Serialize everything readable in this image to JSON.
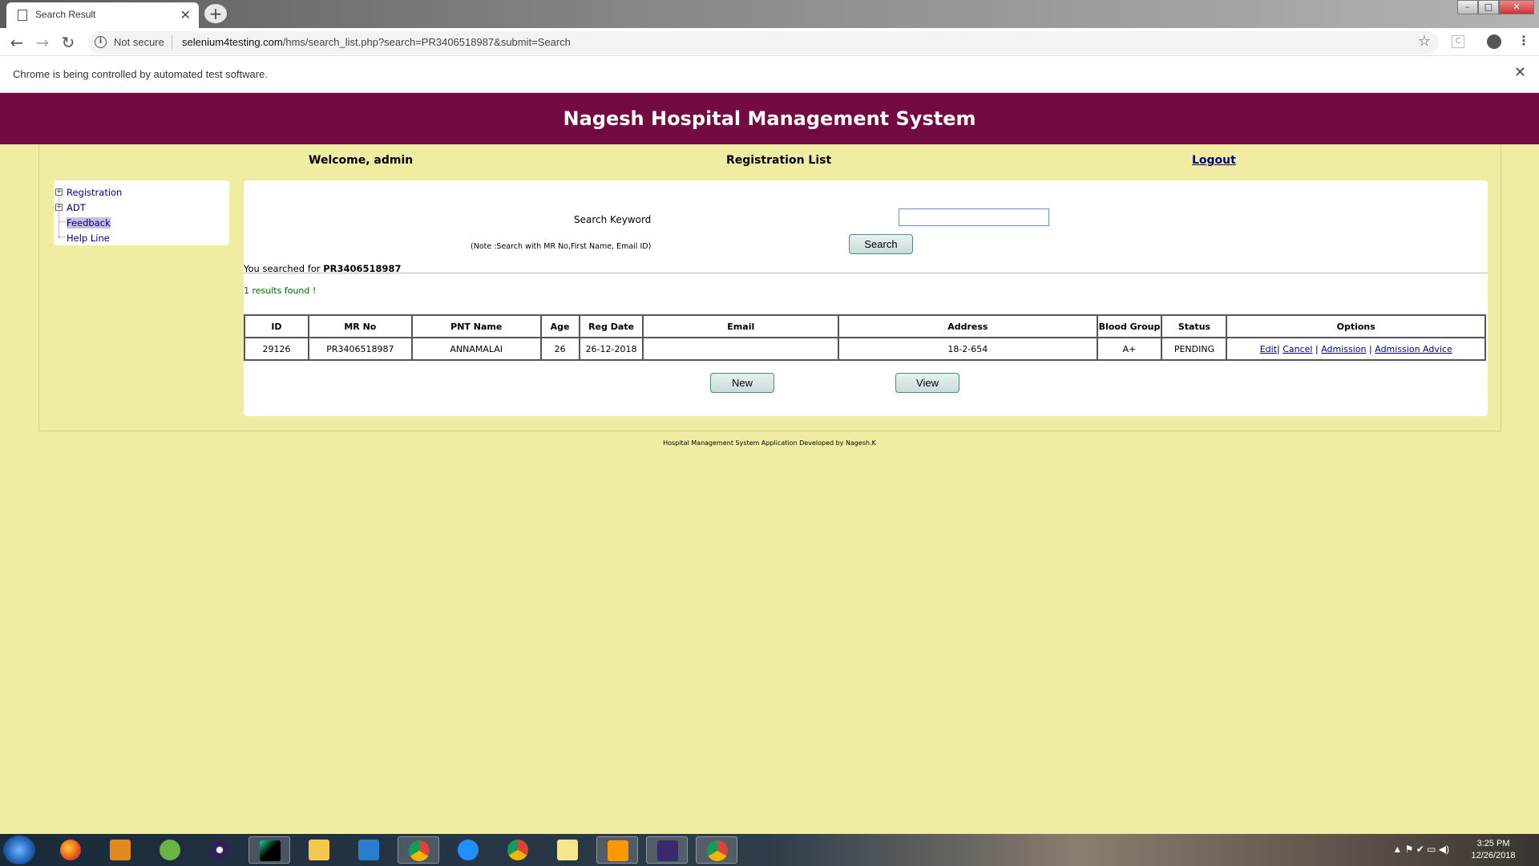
{
  "browser": {
    "tab_title": "Search Result",
    "tab_close": "✕",
    "new_tab": "+",
    "not_secure": "Not secure",
    "url_domain": "selenium4testing.com",
    "url_path": "/hms/search_list.php?search=PR3406518987&submit=Search",
    "infobar_message": "Chrome is being controlled by automated test software.",
    "infobar_close": "✕"
  },
  "header": {
    "title": "Nagesh Hospital Management System"
  },
  "topbar": {
    "welcome": "Welcome, admin",
    "section_title": "Registration List",
    "logout": "Logout"
  },
  "sidebar": {
    "items": [
      {
        "label": "Registration",
        "expand": "+"
      },
      {
        "label": "ADT",
        "expand": "+"
      },
      {
        "label": "Feedback"
      },
      {
        "label": "Help Line"
      }
    ]
  },
  "search": {
    "label": "Search Keyword",
    "value": "",
    "note": "(Note :Search with MR No,First Name, Email ID)",
    "button": "Search",
    "searched_prefix": "You searched for ",
    "searched_term": "PR3406518987",
    "results_found": "1 results found !"
  },
  "table": {
    "columns": [
      "ID",
      "MR No",
      "PNT Name",
      "Age",
      "Reg Date",
      "Email",
      "Address",
      "Blood Group",
      "Status",
      "Options"
    ],
    "rows": [
      {
        "id": "29126",
        "mr_no": "PR3406518987",
        "name": "ANNAMALAI",
        "age": "26",
        "reg_date": "26-12-2018",
        "email": "",
        "address": "18-2-654",
        "blood_group": "A+",
        "status": "PENDING",
        "options": {
          "edit": "Edit",
          "cancel": "Cancel",
          "admission": "Admission",
          "advice": "Admission Advice",
          "sep": "|"
        }
      }
    ]
  },
  "buttons": {
    "new": "New",
    "view": "View"
  },
  "footer": {
    "text": "Hospital Management System Application Developed by Nagesh.K"
  },
  "taskbar": {
    "time": "3:25 PM",
    "date": "12/26/2018",
    "apps": [
      "windows-start",
      "firefox",
      "media-player",
      "android-studio",
      "eclipse",
      "pycharm",
      "file-explorer",
      "visual-studio-code",
      "chrome",
      "internet-explorer",
      "chrome",
      "sticky-notes",
      "sublime-text",
      "eclipse-java-ee",
      "chrome"
    ]
  },
  "colors": {
    "header_bg": "#730a42",
    "page_bg": "#f0eda2",
    "link": "#00008b"
  }
}
